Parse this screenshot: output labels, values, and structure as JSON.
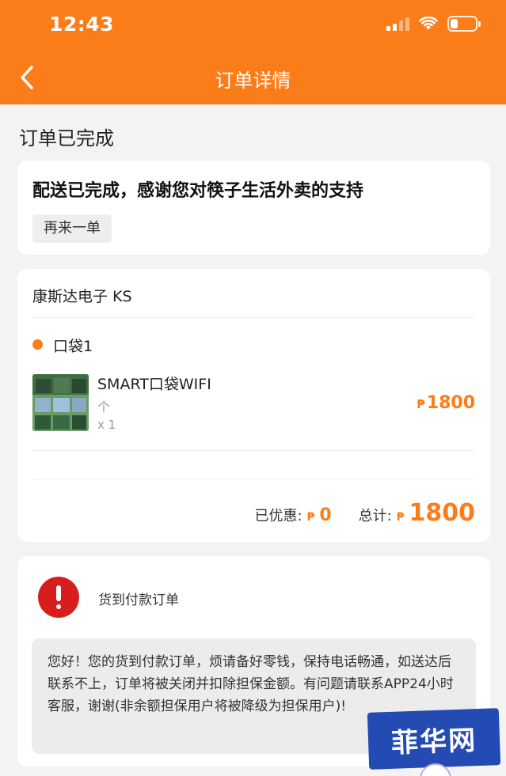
{
  "status_bar": {
    "time": "12:43",
    "battery_level": 0.3
  },
  "nav": {
    "title": "订单详情",
    "back_icon": "chevron-left-icon"
  },
  "section_title": "订单已完成",
  "delivery_card": {
    "message": "配送已完成，感谢您对筷子生活外卖的支持",
    "reorder_label": "再来一单"
  },
  "order_card": {
    "store_name": "康斯达电子 KS",
    "bag_label": "口袋1",
    "item": {
      "name": "SMART口袋WIFI",
      "unit": "个",
      "quantity": "x 1",
      "currency": "₱",
      "price": "1800"
    },
    "discount_label": "已优惠:",
    "discount_currency": "₱",
    "discount_value": "0",
    "total_label": "总计:",
    "total_currency": "₱",
    "total_value": "1800"
  },
  "cod_card": {
    "icon": "alert-icon",
    "title": "货到付款订单",
    "notice": "您好！您的货到付款订单，烦请备好零钱，保持电话畅通，如送达后联系不上，订单将被关闭并扣除担保金额。有问题请联系APP24小时客服，谢谢(非余额担保用户将被降级为担保用户)!"
  },
  "watermark": {
    "text": "菲华网"
  },
  "colors": {
    "brand": "#fb7d1a",
    "alert": "#d81d1d",
    "watermark": "#234bb3"
  }
}
